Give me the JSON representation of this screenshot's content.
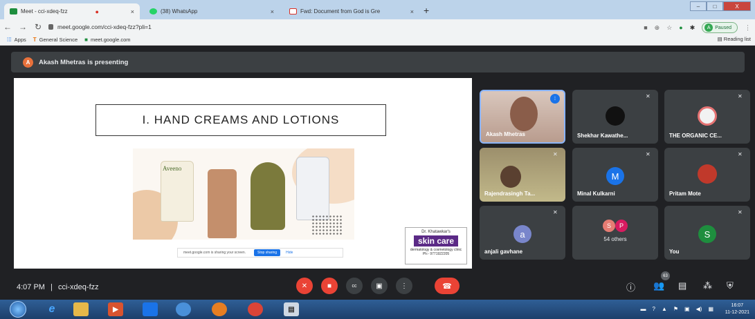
{
  "browser": {
    "tabs": [
      {
        "title": "Meet - cci-xdeq-fzz",
        "recording": "●",
        "close": "×"
      },
      {
        "title": "(38) WhatsApp",
        "close": "×"
      },
      {
        "title": "Fwd: Document from God is Gre",
        "close": "×"
      }
    ],
    "new_tab": "+",
    "window_buttons": {
      "minimize": "–",
      "maximize": "□",
      "close": "X"
    },
    "url": "meet.google.com/cci-xdeq-fzz?pli=1",
    "profile": {
      "initial": "A",
      "status": "Paused"
    },
    "bookmarks": [
      {
        "label": "Apps",
        "icon": "apps-grid-icon"
      },
      {
        "label": "General Science",
        "icon": "science-icon"
      },
      {
        "label": "meet.google.com",
        "icon": "meet-icon"
      }
    ],
    "reading_list": "Reading list"
  },
  "meet": {
    "presenter_bar": {
      "initial": "A",
      "text": "Akash Mhetras is presenting"
    },
    "slide": {
      "title": "I. HAND CREAMS AND LOTIONS",
      "product_brand": "Aveeno",
      "share_notice": "meet.google.com is sharing your screen.",
      "stop_sharing": "Stop sharing",
      "hide": "Hide",
      "logo": {
        "line1": "Dr. Khatawkar's",
        "brand": "skin care",
        "line3": "dermatology & cosmetology clinic",
        "phone": "Ph:- 9771922205"
      }
    },
    "tiles": [
      {
        "name": "Akash Mhetras",
        "type": "video"
      },
      {
        "name": "Shekhar Kawathe...",
        "type": "avatar"
      },
      {
        "name": "THE ORGANIC CE...",
        "type": "avatar"
      },
      {
        "name": "Rajendrasingh Ta...",
        "type": "video"
      },
      {
        "name": "Minal Kulkarni",
        "initial": "M"
      },
      {
        "name": "Pritam Mote",
        "type": "avatar"
      },
      {
        "name": "anjali gavhane",
        "initial": "a"
      },
      {
        "name": "54 others",
        "initials": [
          "S",
          "P"
        ]
      },
      {
        "name": "You",
        "initial": "S"
      }
    ],
    "meeting_info": {
      "time": "4:07 PM",
      "separator": "|",
      "code": "cci-xdeq-fzz"
    },
    "participants_count": "63",
    "colors": {
      "red": "#ea4335",
      "tile": "#3c4043",
      "bg": "#202124",
      "accent": "#1a73e8"
    }
  },
  "taskbar": {
    "clock_time": "16:07",
    "clock_date": "11-12-2021"
  }
}
